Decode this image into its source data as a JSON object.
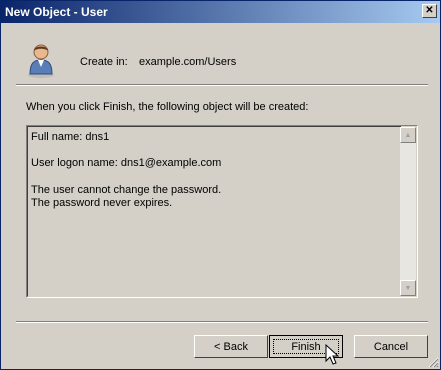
{
  "window": {
    "title": "New Object - User",
    "close_glyph": "✕"
  },
  "header": {
    "create_in_label": "Create in:",
    "create_in_value": "example.com/Users",
    "icon": "user-icon"
  },
  "intro": "When you click Finish, the following object will be created:",
  "summary": {
    "full_name": "Full name: dns1",
    "logon_name": "User logon name: dns1@example.com",
    "line_password_change": "The user cannot change the password.",
    "line_password_expire": "The password never expires."
  },
  "scrollbar": {
    "up_glyph": "▲",
    "down_glyph": "▼"
  },
  "buttons": {
    "back": "< Back",
    "finish": "Finish",
    "cancel": "Cancel"
  },
  "colors": {
    "titlebar_start": "#0a246a",
    "titlebar_end": "#a6caf0",
    "face": "#d4d0c8"
  }
}
